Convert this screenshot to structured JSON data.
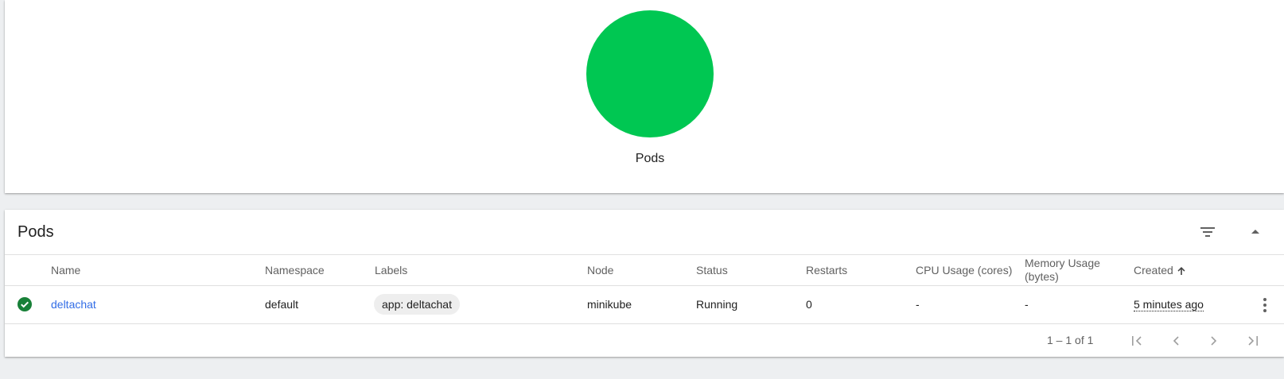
{
  "summary": {
    "chart_label": "Pods",
    "chart_color": "#00c752"
  },
  "pods_card": {
    "title": "Pods",
    "filter_icon": "filter-list-icon",
    "collapse_icon": "arrow-drop-up-icon",
    "columns": {
      "name": "Name",
      "namespace": "Namespace",
      "labels": "Labels",
      "node": "Node",
      "status": "Status",
      "restarts": "Restarts",
      "cpu": "CPU Usage (cores)",
      "memory_line1": "Memory Usage",
      "memory_line2": "(bytes)",
      "created": "Created"
    },
    "rows": [
      {
        "status_icon": "check-circle-icon",
        "status_color": "#188038",
        "name": "deltachat",
        "namespace": "default",
        "label": "app: deltachat",
        "node": "minikube",
        "status": "Running",
        "restarts": "0",
        "cpu": "-",
        "memory": "-",
        "created": "5 minutes ago"
      }
    ],
    "paginator": {
      "range": "1 – 1 of 1"
    }
  },
  "colors": {
    "link": "#326de6",
    "background": "#edeff1",
    "running": "#00c752"
  }
}
